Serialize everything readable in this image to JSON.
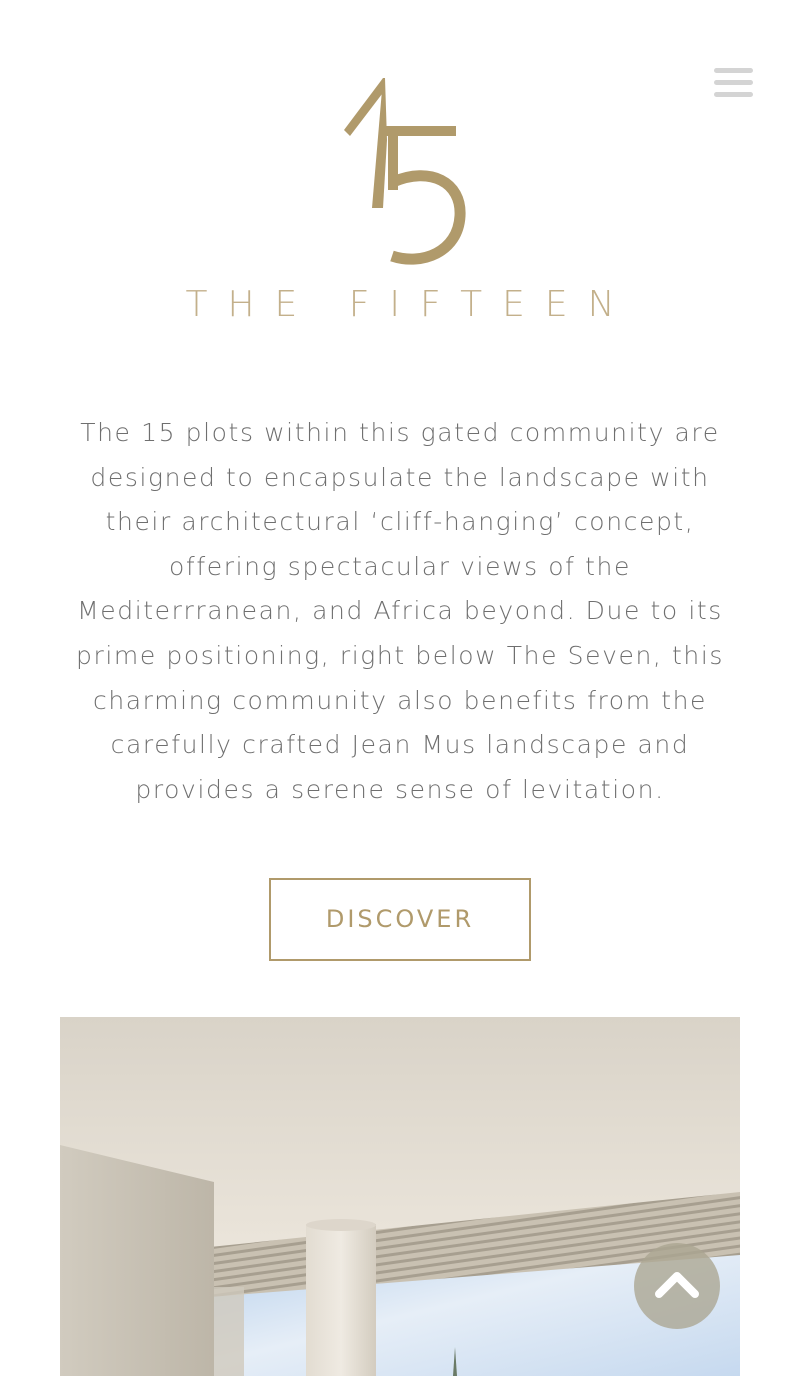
{
  "brand": {
    "name": "THE FIFTEEN",
    "logo_mark": "15",
    "color": "#b09a6b"
  },
  "header": {
    "menu_icon": "hamburger-menu-icon"
  },
  "main": {
    "description": "The 15 plots within this gated community are designed to encapsulate the landscape with their architectural ‘cliff-hanging’ concept, offering spectacular views of the Mediterrranean, and Africa beyond. Due to its prime positioning, right below The Seven, this charming community also benefits from the carefully crafted Jean Mus landscape and provides a serene sense of levitation.",
    "cta_label": "DISCOVER"
  },
  "floating": {
    "scroll_top_icon": "chevron-up-icon"
  }
}
